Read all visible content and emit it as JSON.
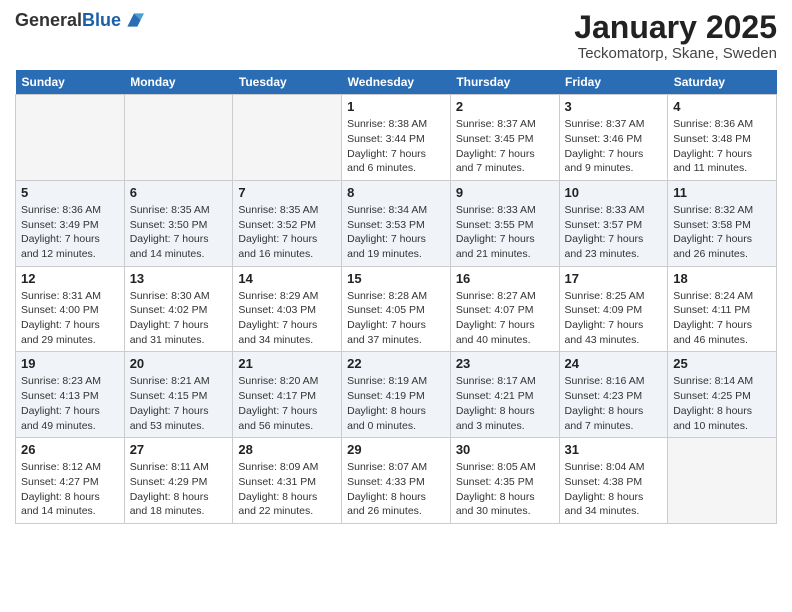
{
  "header": {
    "logo_general": "General",
    "logo_blue": "Blue",
    "month_title": "January 2025",
    "subtitle": "Teckomatorp, Skane, Sweden"
  },
  "days_of_week": [
    "Sunday",
    "Monday",
    "Tuesday",
    "Wednesday",
    "Thursday",
    "Friday",
    "Saturday"
  ],
  "weeks": [
    [
      {
        "day": "",
        "info": ""
      },
      {
        "day": "",
        "info": ""
      },
      {
        "day": "",
        "info": ""
      },
      {
        "day": "1",
        "info": "Sunrise: 8:38 AM\nSunset: 3:44 PM\nDaylight: 7 hours\nand 6 minutes."
      },
      {
        "day": "2",
        "info": "Sunrise: 8:37 AM\nSunset: 3:45 PM\nDaylight: 7 hours\nand 7 minutes."
      },
      {
        "day": "3",
        "info": "Sunrise: 8:37 AM\nSunset: 3:46 PM\nDaylight: 7 hours\nand 9 minutes."
      },
      {
        "day": "4",
        "info": "Sunrise: 8:36 AM\nSunset: 3:48 PM\nDaylight: 7 hours\nand 11 minutes."
      }
    ],
    [
      {
        "day": "5",
        "info": "Sunrise: 8:36 AM\nSunset: 3:49 PM\nDaylight: 7 hours\nand 12 minutes."
      },
      {
        "day": "6",
        "info": "Sunrise: 8:35 AM\nSunset: 3:50 PM\nDaylight: 7 hours\nand 14 minutes."
      },
      {
        "day": "7",
        "info": "Sunrise: 8:35 AM\nSunset: 3:52 PM\nDaylight: 7 hours\nand 16 minutes."
      },
      {
        "day": "8",
        "info": "Sunrise: 8:34 AM\nSunset: 3:53 PM\nDaylight: 7 hours\nand 19 minutes."
      },
      {
        "day": "9",
        "info": "Sunrise: 8:33 AM\nSunset: 3:55 PM\nDaylight: 7 hours\nand 21 minutes."
      },
      {
        "day": "10",
        "info": "Sunrise: 8:33 AM\nSunset: 3:57 PM\nDaylight: 7 hours\nand 23 minutes."
      },
      {
        "day": "11",
        "info": "Sunrise: 8:32 AM\nSunset: 3:58 PM\nDaylight: 7 hours\nand 26 minutes."
      }
    ],
    [
      {
        "day": "12",
        "info": "Sunrise: 8:31 AM\nSunset: 4:00 PM\nDaylight: 7 hours\nand 29 minutes."
      },
      {
        "day": "13",
        "info": "Sunrise: 8:30 AM\nSunset: 4:02 PM\nDaylight: 7 hours\nand 31 minutes."
      },
      {
        "day": "14",
        "info": "Sunrise: 8:29 AM\nSunset: 4:03 PM\nDaylight: 7 hours\nand 34 minutes."
      },
      {
        "day": "15",
        "info": "Sunrise: 8:28 AM\nSunset: 4:05 PM\nDaylight: 7 hours\nand 37 minutes."
      },
      {
        "day": "16",
        "info": "Sunrise: 8:27 AM\nSunset: 4:07 PM\nDaylight: 7 hours\nand 40 minutes."
      },
      {
        "day": "17",
        "info": "Sunrise: 8:25 AM\nSunset: 4:09 PM\nDaylight: 7 hours\nand 43 minutes."
      },
      {
        "day": "18",
        "info": "Sunrise: 8:24 AM\nSunset: 4:11 PM\nDaylight: 7 hours\nand 46 minutes."
      }
    ],
    [
      {
        "day": "19",
        "info": "Sunrise: 8:23 AM\nSunset: 4:13 PM\nDaylight: 7 hours\nand 49 minutes."
      },
      {
        "day": "20",
        "info": "Sunrise: 8:21 AM\nSunset: 4:15 PM\nDaylight: 7 hours\nand 53 minutes."
      },
      {
        "day": "21",
        "info": "Sunrise: 8:20 AM\nSunset: 4:17 PM\nDaylight: 7 hours\nand 56 minutes."
      },
      {
        "day": "22",
        "info": "Sunrise: 8:19 AM\nSunset: 4:19 PM\nDaylight: 8 hours\nand 0 minutes."
      },
      {
        "day": "23",
        "info": "Sunrise: 8:17 AM\nSunset: 4:21 PM\nDaylight: 8 hours\nand 3 minutes."
      },
      {
        "day": "24",
        "info": "Sunrise: 8:16 AM\nSunset: 4:23 PM\nDaylight: 8 hours\nand 7 minutes."
      },
      {
        "day": "25",
        "info": "Sunrise: 8:14 AM\nSunset: 4:25 PM\nDaylight: 8 hours\nand 10 minutes."
      }
    ],
    [
      {
        "day": "26",
        "info": "Sunrise: 8:12 AM\nSunset: 4:27 PM\nDaylight: 8 hours\nand 14 minutes."
      },
      {
        "day": "27",
        "info": "Sunrise: 8:11 AM\nSunset: 4:29 PM\nDaylight: 8 hours\nand 18 minutes."
      },
      {
        "day": "28",
        "info": "Sunrise: 8:09 AM\nSunset: 4:31 PM\nDaylight: 8 hours\nand 22 minutes."
      },
      {
        "day": "29",
        "info": "Sunrise: 8:07 AM\nSunset: 4:33 PM\nDaylight: 8 hours\nand 26 minutes."
      },
      {
        "day": "30",
        "info": "Sunrise: 8:05 AM\nSunset: 4:35 PM\nDaylight: 8 hours\nand 30 minutes."
      },
      {
        "day": "31",
        "info": "Sunrise: 8:04 AM\nSunset: 4:38 PM\nDaylight: 8 hours\nand 34 minutes."
      },
      {
        "day": "",
        "info": ""
      }
    ]
  ]
}
